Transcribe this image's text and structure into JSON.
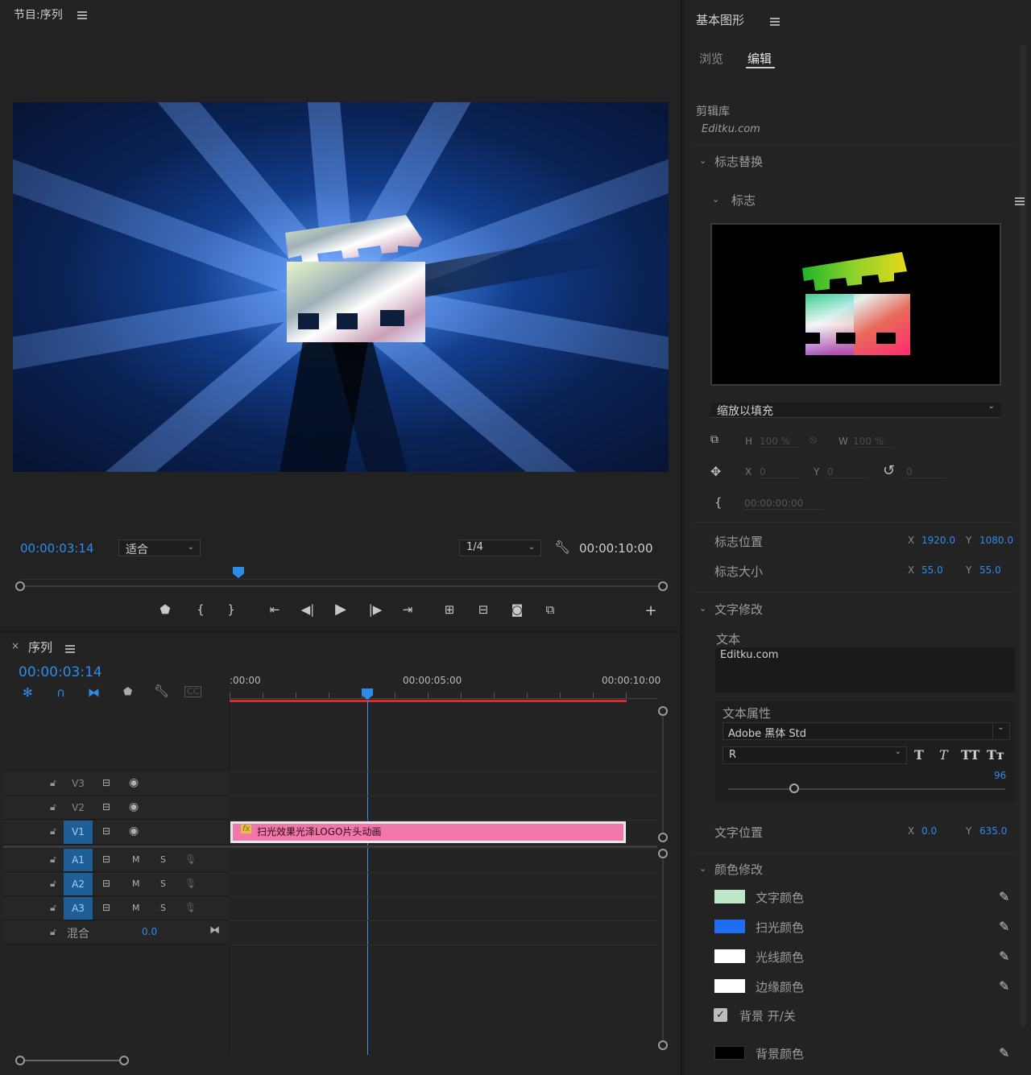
{
  "program_monitor": {
    "title": "节目:序列",
    "timecode_current": "00:00:03:14",
    "fit_dropdown": "适合",
    "resolution_dropdown": "1/4",
    "timecode_duration": "00:00:10:00"
  },
  "timeline": {
    "panel_title": "序列",
    "close_label": "×",
    "timecode": "00:00:03:14",
    "ruler": [
      ":00:00",
      "00:00:05:00",
      "00:00:10:00"
    ],
    "video_tracks": [
      "V3",
      "V2",
      "V1"
    ],
    "audio_tracks": [
      "A1",
      "A2",
      "A3"
    ],
    "mute_label": "M",
    "solo_label": "S",
    "mix_label": "混合",
    "mix_value": "0.0",
    "clip": {
      "fx": "fx",
      "name": "扫光效果光泽LOGO片头动画"
    },
    "playhead_position": 0.35
  },
  "essential_graphics": {
    "title": "基本图形",
    "tabs": [
      "浏览",
      "编辑"
    ],
    "active_tab": "编辑",
    "library_label": "剪辑库",
    "library_value": "Editku.com",
    "section_logo_replace": "标志替换",
    "logo_group": "标志",
    "scale_dropdown": "缩放以填充",
    "transform": {
      "h_label": "H",
      "h_value": "100 %",
      "w_label": "W",
      "w_value": "100 %",
      "x_label": "X",
      "x_value": "0",
      "y_label": "Y",
      "y_value": "0",
      "rot_value": "0",
      "time_value": "00:00:00:00"
    },
    "logo_position": {
      "label": "标志位置",
      "x_label": "X",
      "x": "1920.0",
      "y_label": "Y",
      "y": "1080.0"
    },
    "logo_size": {
      "label": "标志大小",
      "x_label": "X",
      "x": "55.0",
      "y_label": "Y",
      "y": "55.0"
    },
    "section_text": "文字修改",
    "text_label": "文本",
    "text_value": "Editku.com",
    "text_props_label": "文本属性",
    "font_name": "Adobe 黑体 Std",
    "font_style": "R",
    "font_size": "96",
    "text_position": {
      "label": "文字位置",
      "x_label": "X",
      "x": "0.0",
      "y_label": "Y",
      "y": "635.0"
    },
    "section_color": "颜色修改",
    "colors": [
      {
        "label": "文字颜色",
        "color": "#bfe6c8"
      },
      {
        "label": "扫光颜色",
        "color": "#1f6ef2"
      },
      {
        "label": "光线颜色",
        "color": "#ffffff"
      },
      {
        "label": "边缘颜色",
        "color": "#ffffff"
      }
    ],
    "bg_toggle_label": "背景 开/关",
    "bg_toggle_checked": true,
    "bg_color": {
      "label": "背景颜色",
      "color": "#000000"
    }
  }
}
